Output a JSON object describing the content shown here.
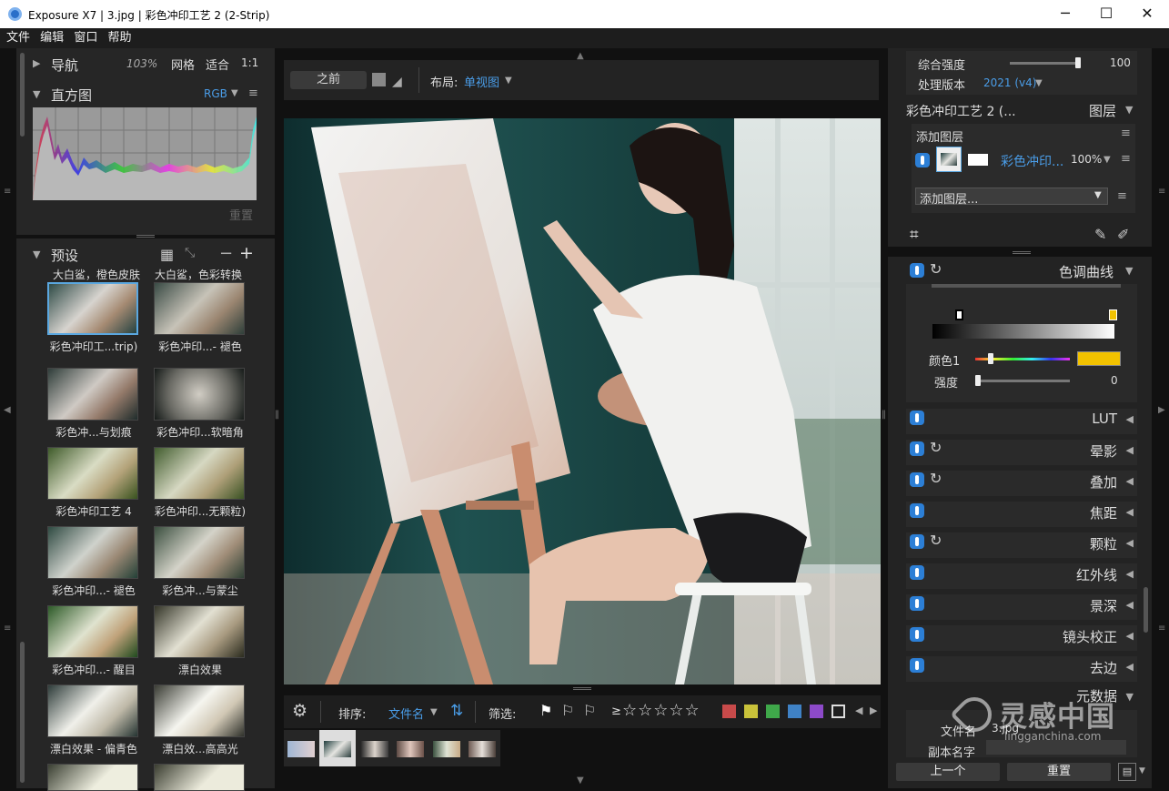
{
  "window": {
    "title": "Exposure X7 | 3.jpg | 彩色冲印工艺 2 (2-Strip)"
  },
  "menu": [
    "文件",
    "编辑",
    "窗口",
    "帮助"
  ],
  "navigator": {
    "label": "导航",
    "zoom": "103%",
    "grid": "网格",
    "fit": "适合",
    "ratio": "1:1"
  },
  "histogram": {
    "label": "直方图",
    "mode": "RGB",
    "reset": "重置"
  },
  "presets": {
    "label": "预设",
    "top_labels": [
      "大白鲨，橙色皮肤",
      "大白鲨，色彩转换"
    ],
    "items": [
      "彩色冲印工...trip)",
      "彩色冲印...- 褪色",
      "彩色冲...与划痕",
      "彩色冲印...软暗角",
      "彩色冲印工艺 4",
      "彩色冲印...无颗粒)",
      "彩色冲印...- 褪色",
      "彩色冲...与蒙尘",
      "彩色冲印...- 醒目",
      "漂白效果",
      "漂白效果 - 偏青色",
      "漂白效...高高光"
    ]
  },
  "center_toolbar": {
    "before": "之前",
    "layout_label": "布局:",
    "layout_value": "单视图"
  },
  "bottom_toolbar": {
    "sort_label": "排序:",
    "sort_value": "文件名",
    "filter_label": "筛选:",
    "ge": "≥"
  },
  "colors": {
    "accent": "#2c7fd6",
    "label_red": "#c84a4a",
    "label_yellow": "#c9c23a",
    "label_green": "#3fa84a",
    "label_blue": "#3f82c6",
    "label_purple": "#8d4ac9",
    "swatch": "#f2c200"
  },
  "right": {
    "overall_label": "综合强度",
    "overall_value": "100",
    "version_label": "处理版本",
    "version_value": "2021 (v4)",
    "layer_title": "彩色冲印工艺 2 (...",
    "layers_label": "图层",
    "add_layer": "添加图层",
    "layer_name": "彩色冲印...",
    "layer_opacity": "100%",
    "add_layer_dropdown": "添加图层...",
    "curve_label": "色调曲线",
    "color1_label": "颜色1",
    "strength_label": "强度",
    "strength_value": "0",
    "panels": [
      "LUT",
      "晕影",
      "叠加",
      "焦距",
      "颗粒",
      "红外线",
      "景深",
      "镜头校正",
      "去边",
      "元数据"
    ],
    "filename_label": "文件名",
    "filename_value": "3.jpg",
    "copyname_label": "副本名字",
    "prev": "上一个",
    "reset": "重置"
  },
  "watermark": {
    "cn": "灵感中国",
    "url": "lingganchina.com"
  }
}
